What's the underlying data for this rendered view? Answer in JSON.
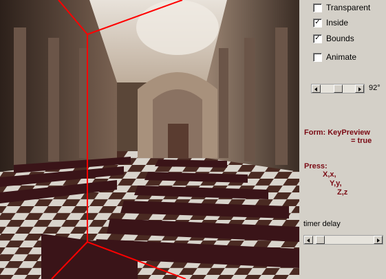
{
  "panel": {
    "options": [
      {
        "label": "Transparent",
        "checked": false
      },
      {
        "label": "Inside",
        "checked": true
      },
      {
        "label": "Bounds",
        "checked": true
      },
      {
        "label": "Animate",
        "checked": false
      }
    ],
    "angle": {
      "value_text": "92°",
      "level": 0.5
    },
    "form_info": {
      "line1": "Form: KeyPreview",
      "line2": "= true"
    },
    "press_info": {
      "title": "Press:",
      "keys": [
        "X,x,",
        "Y,y,",
        "Z,z"
      ]
    },
    "timer": {
      "label": "timer delay",
      "level": 0.05
    }
  },
  "colors": {
    "bounds_line": "#ff0000",
    "info_text": "#7a0a14",
    "panel_bg": "#d4d0c8"
  }
}
